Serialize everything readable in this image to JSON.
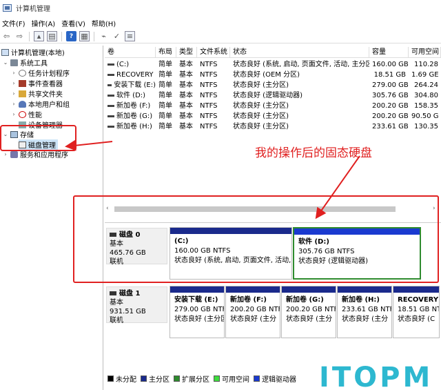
{
  "window": {
    "title": "计算机管理"
  },
  "menu": [
    "文件(F)",
    "操作(A)",
    "查看(V)",
    "帮助(H)"
  ],
  "tree": {
    "root": "计算机管理(本地)",
    "system_tools": "系统工具",
    "task_scheduler": "任务计划程序",
    "event_viewer": "事件查看器",
    "shared_folders": "共享文件夹",
    "local_users": "本地用户和组",
    "performance": "性能",
    "device_manager": "设备管理器",
    "storage": "存储",
    "disk_management": "磁盘管理",
    "services": "服务和应用程序"
  },
  "columns": [
    "卷",
    "布局",
    "类型",
    "文件系统",
    "状态",
    "容量",
    "可用空间"
  ],
  "volumes": [
    {
      "name": "(C:)",
      "layout": "简单",
      "type": "基本",
      "fs": "NTFS",
      "status": "状态良好 (系统, 启动, 页面文件, 活动, 主分区)",
      "capacity": "160.00 GB",
      "free": "110.28"
    },
    {
      "name": "RECOVERY",
      "layout": "简单",
      "type": "基本",
      "fs": "NTFS",
      "status": "状态良好 (OEM 分区)",
      "capacity": "18.51 GB",
      "free": "1.69 GE"
    },
    {
      "name": "安装下载 (E:)",
      "layout": "简单",
      "type": "基本",
      "fs": "NTFS",
      "status": "状态良好 (主分区)",
      "capacity": "279.00 GB",
      "free": "264.24"
    },
    {
      "name": "软件 (D:)",
      "layout": "简单",
      "type": "基本",
      "fs": "NTFS",
      "status": "状态良好 (逻辑驱动器)",
      "capacity": "305.76 GB",
      "free": "304.80"
    },
    {
      "name": "新加卷 (F:)",
      "layout": "简单",
      "type": "基本",
      "fs": "NTFS",
      "status": "状态良好 (主分区)",
      "capacity": "200.20 GB",
      "free": "158.35"
    },
    {
      "name": "新加卷 (G:)",
      "layout": "简单",
      "type": "基本",
      "fs": "NTFS",
      "status": "状态良好 (主分区)",
      "capacity": "200.20 GB",
      "free": "90.50 G"
    },
    {
      "name": "新加卷 (H:)",
      "layout": "简单",
      "type": "基本",
      "fs": "NTFS",
      "status": "状态良好 (主分区)",
      "capacity": "233.61 GB",
      "free": "130.35"
    }
  ],
  "disk0": {
    "name": "磁盘 0",
    "type": "基本",
    "size": "465.76 GB",
    "state": "联机",
    "partitions": [
      {
        "label": "(C:)",
        "size": "160.00 GB NTFS",
        "status": "状态良好 (系统, 启动, 页面文件, 活动, 主"
      },
      {
        "label": "软件 (D:)",
        "size": "305.76 GB NTFS",
        "status": "状态良好 (逻辑驱动器)"
      }
    ]
  },
  "disk1": {
    "name": "磁盘 1",
    "type": "基本",
    "size": "931.51 GB",
    "state": "联机",
    "partitions": [
      {
        "label": "安装下载 (E:)",
        "size": "279.00 GB NTFS",
        "status": "状态良好 (主分区"
      },
      {
        "label": "新加卷 (F:)",
        "size": "200.20 GB NTF",
        "status": "状态良好 (主分"
      },
      {
        "label": "新加卷 (G:)",
        "size": "200.20 GB NTF",
        "status": "状态良好 (主分"
      },
      {
        "label": "新加卷 (H:)",
        "size": "233.61 GB NTF",
        "status": "状态良好 (主分"
      },
      {
        "label": "RECOVERY",
        "size": "18.51 GB NT",
        "status": "状态良好 (C"
      }
    ]
  },
  "legend": [
    {
      "label": "未分配",
      "color": "#000000"
    },
    {
      "label": "主分区",
      "color": "#1a2a8c"
    },
    {
      "label": "扩展分区",
      "color": "#2e8b2e"
    },
    {
      "label": "可用空间",
      "color": "#3fdc3f"
    },
    {
      "label": "逻辑驱动器",
      "color": "#1a3ad0"
    }
  ],
  "annotation": "我的操作后的固态硬盘",
  "watermark": "ITOPM"
}
